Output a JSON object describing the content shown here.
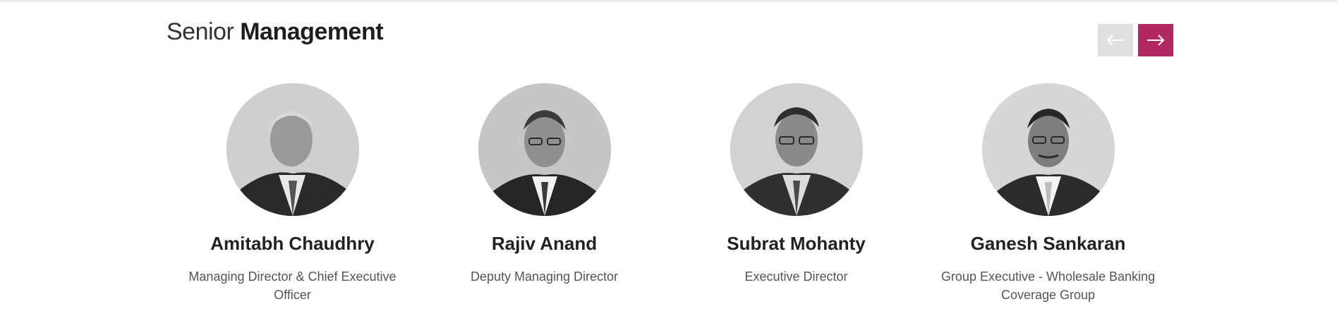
{
  "section": {
    "title_light": "Senior",
    "title_bold": "Management"
  },
  "carousel": {
    "prev_icon": "arrow-left-icon",
    "next_icon": "arrow-right-icon",
    "prev_color": "#e0e0e0",
    "next_color": "#b0285f"
  },
  "members": [
    {
      "name": "Amitabh Chaudhry",
      "role": "Managing Director & Chief Executive Officer",
      "photo": "portrait-photo"
    },
    {
      "name": "Rajiv Anand",
      "role": "Deputy Managing Director",
      "photo": "portrait-photo"
    },
    {
      "name": "Subrat Mohanty",
      "role": "Executive Director",
      "photo": "portrait-photo"
    },
    {
      "name": "Ganesh Sankaran",
      "role": "Group Executive - Wholesale Banking Coverage Group",
      "photo": "portrait-photo"
    }
  ]
}
